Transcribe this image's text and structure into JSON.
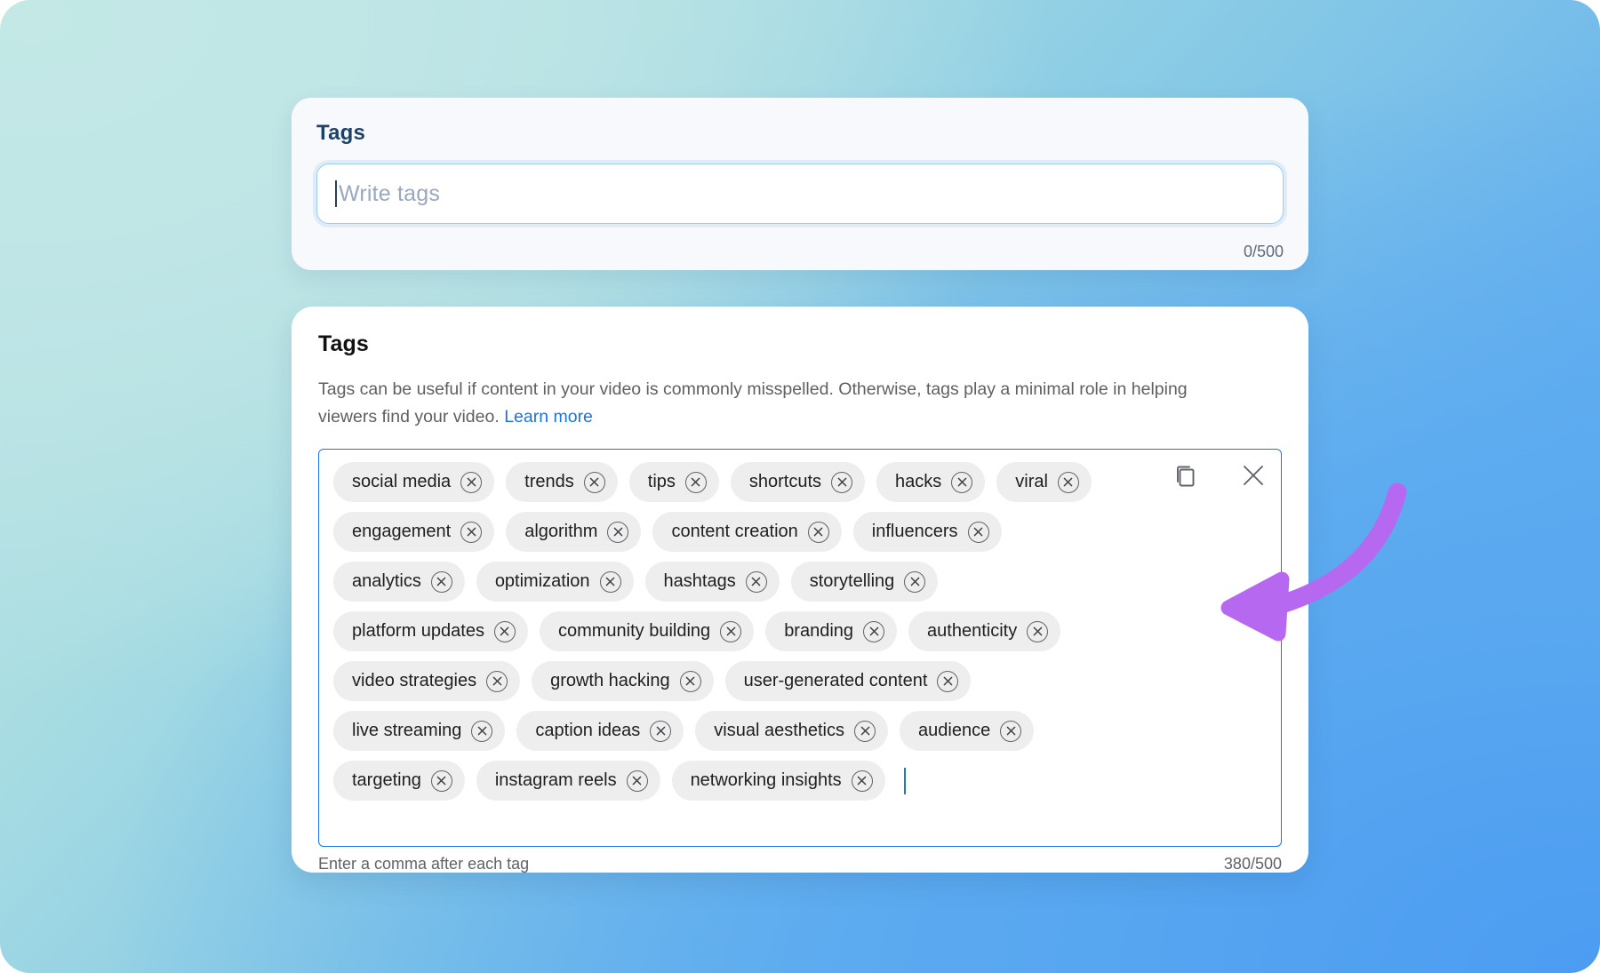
{
  "background": {
    "gradient_from": "#bce4e4",
    "gradient_mid": "#86c9e6",
    "gradient_to": "#4f9df3"
  },
  "card_one": {
    "title": "Tags",
    "input_value": "",
    "input_placeholder": "Write tags",
    "counter": "0/500",
    "border_color": "#9ccdee",
    "title_color": "#1d4266"
  },
  "card_two": {
    "title": "Tags",
    "description": "Tags can be useful if content in your video is commonly misspelled. Otherwise, tags play a minimal role in helping viewers find your video.",
    "learn_more_label": "Learn more",
    "learn_more_color": "#1a73e8",
    "box_border_color": "#1a73e8",
    "hint": "Enter a comma after each tag",
    "counter": "380/500",
    "actions": {
      "copy_label": "copy-icon",
      "close_label": "close-icon"
    },
    "tag_rows": [
      [
        "social media",
        "trends",
        "tips",
        "shortcuts",
        "hacks",
        "viral"
      ],
      [
        "engagement",
        "algorithm",
        "content creation",
        "influencers"
      ],
      [
        "analytics",
        "optimization",
        "hashtags",
        "storytelling"
      ],
      [
        "platform updates",
        "community building",
        "branding",
        "authenticity"
      ],
      [
        "video strategies",
        "growth hacking",
        "user-generated content"
      ],
      [
        "live streaming",
        "caption ideas",
        "visual aesthetics",
        "audience"
      ],
      [
        "targeting",
        "instagram reels",
        "networking insights"
      ]
    ],
    "chip_bg": "#eeeeee",
    "chip_text_color": "#1f1f1f"
  },
  "annotation": {
    "arrow_color": "#b668f0",
    "arrow_direction": "left",
    "arrow_name": "purple-curved-arrow"
  }
}
